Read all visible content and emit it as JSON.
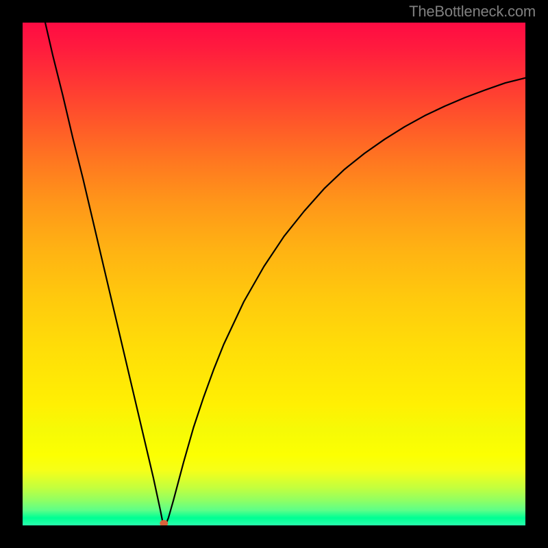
{
  "watermark": "TheBottleneck.com",
  "colors": {
    "curve_stroke": "#000000",
    "marker_fill": "#d8633c",
    "background": "#000000"
  },
  "chart_data": {
    "type": "line",
    "title": "",
    "xlabel": "",
    "ylabel": "",
    "x_range": [
      0,
      100
    ],
    "y_range": [
      0,
      100
    ],
    "grid": false,
    "legend": false,
    "marker": {
      "x": 28.1,
      "y": 0.0
    },
    "curve": [
      {
        "x": 4.5,
        "y": 100.0
      },
      {
        "x": 6.0,
        "y": 93.5
      },
      {
        "x": 8.0,
        "y": 85.5
      },
      {
        "x": 10.0,
        "y": 77.0
      },
      {
        "x": 12.0,
        "y": 69.0
      },
      {
        "x": 14.0,
        "y": 60.5
      },
      {
        "x": 16.0,
        "y": 52.0
      },
      {
        "x": 18.0,
        "y": 43.5
      },
      {
        "x": 20.0,
        "y": 35.0
      },
      {
        "x": 22.0,
        "y": 26.5
      },
      {
        "x": 24.0,
        "y": 18.0
      },
      {
        "x": 26.0,
        "y": 9.5
      },
      {
        "x": 27.4,
        "y": 3.0
      },
      {
        "x": 27.8,
        "y": 1.0
      },
      {
        "x": 28.1,
        "y": 0.0
      },
      {
        "x": 28.4,
        "y": 0.0
      },
      {
        "x": 29.0,
        "y": 1.5
      },
      {
        "x": 30.0,
        "y": 5.0
      },
      {
        "x": 32.0,
        "y": 12.5
      },
      {
        "x": 34.0,
        "y": 19.5
      },
      {
        "x": 36.0,
        "y": 25.5
      },
      {
        "x": 38.0,
        "y": 31.0
      },
      {
        "x": 40.0,
        "y": 36.0
      },
      {
        "x": 44.0,
        "y": 44.5
      },
      {
        "x": 48.0,
        "y": 51.5
      },
      {
        "x": 52.0,
        "y": 57.5
      },
      {
        "x": 56.0,
        "y": 62.5
      },
      {
        "x": 60.0,
        "y": 67.0
      },
      {
        "x": 64.0,
        "y": 70.8
      },
      {
        "x": 68.0,
        "y": 74.0
      },
      {
        "x": 72.0,
        "y": 76.8
      },
      {
        "x": 76.0,
        "y": 79.3
      },
      {
        "x": 80.0,
        "y": 81.5
      },
      {
        "x": 84.0,
        "y": 83.4
      },
      {
        "x": 88.0,
        "y": 85.1
      },
      {
        "x": 92.0,
        "y": 86.6
      },
      {
        "x": 96.0,
        "y": 88.0
      },
      {
        "x": 100.0,
        "y": 89.0
      }
    ]
  }
}
